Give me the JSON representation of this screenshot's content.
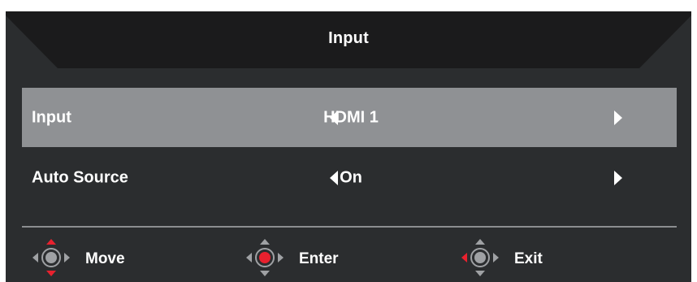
{
  "osd": {
    "title": "Input",
    "rows": [
      {
        "label": "Input",
        "value": "HDMI 1",
        "selected": true
      },
      {
        "label": "Auto Source",
        "value": "On",
        "selected": false
      }
    ],
    "hints": [
      {
        "label": "Move",
        "icon": "joystick-move-icon"
      },
      {
        "label": "Enter",
        "icon": "joystick-enter-icon"
      },
      {
        "label": "Exit",
        "icon": "joystick-exit-icon"
      }
    ]
  },
  "colors": {
    "panel": "#2b2d2f",
    "header": "#1b1b1c",
    "selected_row": "#8f9194",
    "accent_red": "#e8212e",
    "icon_gray": "#9fa1a4"
  }
}
